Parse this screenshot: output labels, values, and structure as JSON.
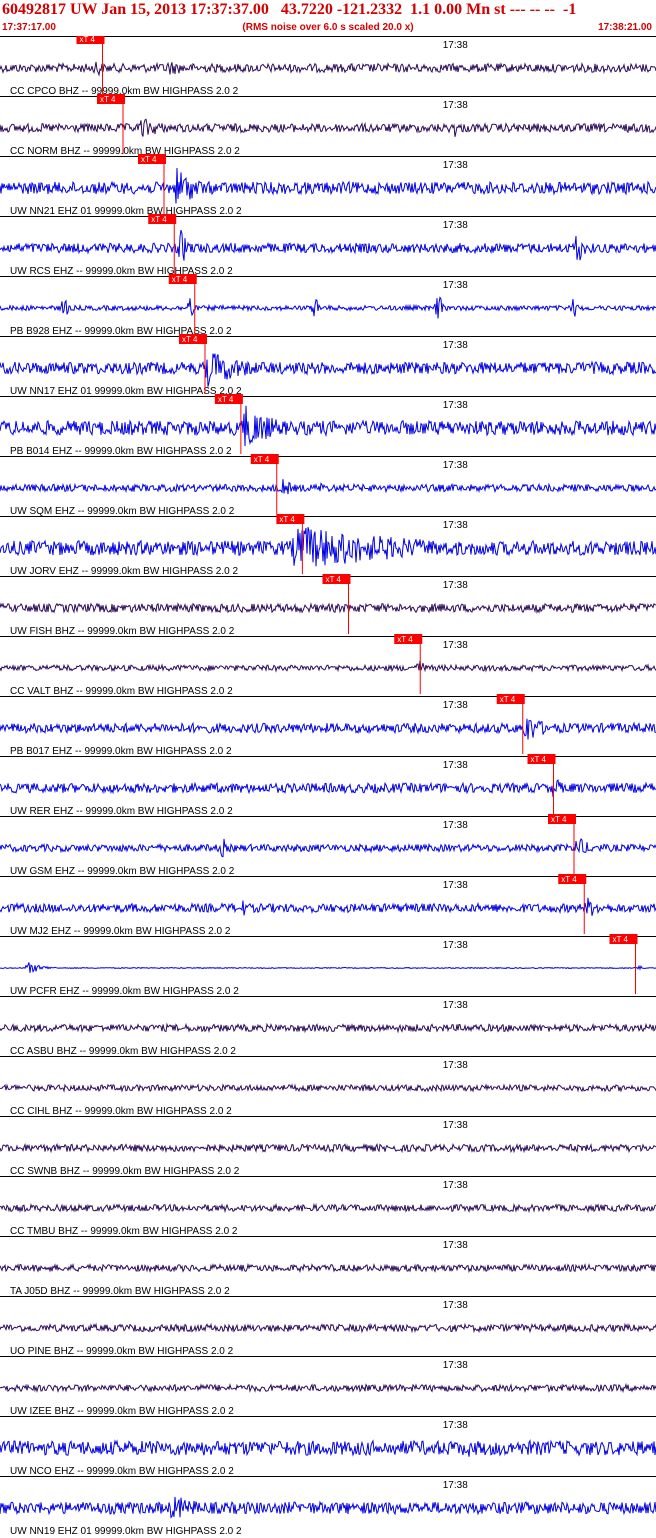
{
  "header": {
    "title": "60492817 UW Jan 15, 2013 17:37:37.00   43.7220 -121.2332  1.1 0.00 Mn st --- -- --  -1",
    "start_time": "17:37:17.00",
    "scale_note": "(RMS noise over 6.0 s scaled 20.0 x)",
    "end_time": "17:38:21.00"
  },
  "colors": {
    "blue_trace": "#0000e6",
    "dark_trace": "#2a0a5a",
    "pick": "#ff0000",
    "text": "#d40000",
    "label": "#000000"
  },
  "chart_data": {
    "type": "seismogram",
    "time_range": [
      "17:37:17.00",
      "17:38:21.00"
    ],
    "time_range_s": [
      0,
      64
    ],
    "minute_tick_label": "17:38",
    "minute_tick_s": 43,
    "pick_label": "xT 4",
    "traces": [
      {
        "label": "CC CPCO BHZ -- 99999.0km BW  HIGHPASS  2.0  2",
        "color": "dark",
        "pick_s": 10.0,
        "noise": 0.18,
        "bursts": [
          {
            "t": 9.2,
            "amp": 0.55,
            "dur": 1.0
          },
          {
            "t": 16.0,
            "amp": 0.35,
            "dur": 6.0
          }
        ]
      },
      {
        "label": "CC NORM BHZ -- 99999.0km BW  HIGHPASS  2.0  2",
        "color": "dark",
        "pick_s": 12.0,
        "noise": 0.18,
        "bursts": [
          {
            "t": 13.5,
            "amp": 0.45,
            "dur": 6.0
          },
          {
            "t": 44.0,
            "amp": 0.55,
            "dur": 0.6
          },
          {
            "t": 52.0,
            "amp": 0.2,
            "dur": 6.0
          }
        ]
      },
      {
        "label": "UW NN21 EHZ 01 99999.0km BW  HIGHPASS  2.0  2",
        "color": "blue",
        "pick_s": 16.0,
        "noise": 0.25,
        "bursts": [
          {
            "t": 17.0,
            "amp": 0.9,
            "dur": 5.0
          }
        ]
      },
      {
        "label": "UW RCS EHZ -- 99999.0km BW  HIGHPASS  2.0  2",
        "color": "blue",
        "pick_s": 17.0,
        "noise": 0.2,
        "bursts": [
          {
            "t": 17.3,
            "amp": 0.8,
            "dur": 2.0
          },
          {
            "t": 56.0,
            "amp": 0.8,
            "dur": 1.5
          }
        ]
      },
      {
        "label": "PB B928 EHZ -- 99999.0km BW  HIGHPASS  2.0  2",
        "color": "blue",
        "pick_s": 19.0,
        "noise": 0.1,
        "bursts": [
          {
            "t": 6.0,
            "amp": 0.6,
            "dur": 0.8
          },
          {
            "t": 18.3,
            "amp": 0.7,
            "dur": 0.8
          },
          {
            "t": 30.5,
            "amp": 0.6,
            "dur": 0.8
          },
          {
            "t": 42.5,
            "amp": 0.7,
            "dur": 0.8
          },
          {
            "t": 55.7,
            "amp": 0.5,
            "dur": 0.8
          }
        ]
      },
      {
        "label": "UW NN17 EHZ 01 99999.0km BW  HIGHPASS  2.0  2",
        "color": "blue",
        "pick_s": 20.0,
        "noise": 0.25,
        "bursts": [
          {
            "t": 20.0,
            "amp": 0.8,
            "dur": 9.0
          }
        ]
      },
      {
        "label": "PB B014 EHZ -- 99999.0km BW  HIGHPASS  2.0  2",
        "color": "blue",
        "pick_s": 23.5,
        "noise": 0.3,
        "bursts": [
          {
            "t": 23.5,
            "amp": 1.0,
            "dur": 7.0
          }
        ]
      },
      {
        "label": "UW SQM EHZ -- 99999.0km BW  HIGHPASS  2.0  2",
        "color": "blue",
        "pick_s": 27.0,
        "noise": 0.15,
        "bursts": [
          {
            "t": 27.5,
            "amp": 0.6,
            "dur": 1.0
          },
          {
            "t": 31.0,
            "amp": 0.3,
            "dur": 1.0
          }
        ]
      },
      {
        "label": "UW JORV EHZ -- 99999.0km BW  HIGHPASS  2.0  2",
        "color": "blue",
        "pick_s": 29.5,
        "noise": 0.3,
        "bursts": [
          {
            "t": 28.5,
            "amp": 1.0,
            "dur": 27.0
          }
        ]
      },
      {
        "label": "UW FISH BHZ -- 99999.0km BW  HIGHPASS  2.0  2",
        "color": "dark",
        "pick_s": 34.0,
        "noise": 0.18,
        "bursts": []
      },
      {
        "label": "CC VALT BHZ -- 99999.0km BW  HIGHPASS  2.0  2",
        "color": "dark",
        "pick_s": 41.0,
        "noise": 0.12,
        "bursts": [
          {
            "t": 40.5,
            "amp": 0.45,
            "dur": 1.5
          }
        ]
      },
      {
        "label": "PB B017 EHZ -- 99999.0km BW  HIGHPASS  2.0  2",
        "color": "blue",
        "pick_s": 51.0,
        "noise": 0.2,
        "bursts": [
          {
            "t": 51.0,
            "amp": 0.7,
            "dur": 4.0
          }
        ]
      },
      {
        "label": "UW RER EHZ -- 99999.0km BW  HIGHPASS  2.0  2",
        "color": "blue",
        "pick_s": 54.0,
        "noise": 0.2,
        "bursts": [
          {
            "t": 53.8,
            "amp": 0.6,
            "dur": 1.5
          }
        ]
      },
      {
        "label": "UW GSM EHZ -- 99999.0km BW  HIGHPASS  2.0  2",
        "color": "blue",
        "pick_s": 56.0,
        "noise": 0.15,
        "bursts": [
          {
            "t": 21.5,
            "amp": 0.5,
            "dur": 0.6
          },
          {
            "t": 56.0,
            "amp": 0.5,
            "dur": 3.0
          }
        ]
      },
      {
        "label": "UW MJ2 EHZ -- 99999.0km BW  HIGHPASS  2.0  2",
        "color": "blue",
        "pick_s": 57.0,
        "noise": 0.18,
        "bursts": [
          {
            "t": 23.5,
            "amp": 0.4,
            "dur": 0.6
          },
          {
            "t": 57.0,
            "amp": 0.45,
            "dur": 4.0
          }
        ]
      },
      {
        "label": "UW PCFR EHZ -- 99999.0km BW  HIGHPASS  2.0  2",
        "color": "blue",
        "pick_s": 62.0,
        "noise": 0.02,
        "bursts": [
          {
            "t": 2.5,
            "amp": 0.25,
            "dur": 3.0
          },
          {
            "t": 62.0,
            "amp": 0.2,
            "dur": 0.6
          }
        ]
      },
      {
        "label": "CC ASBU BHZ -- 99999.0km BW  HIGHPASS  2.0  2",
        "color": "dark",
        "pick_s": null,
        "noise": 0.15,
        "bursts": []
      },
      {
        "label": "CC CIHL BHZ -- 99999.0km BW  HIGHPASS  2.0  2",
        "color": "dark",
        "pick_s": null,
        "noise": 0.13,
        "bursts": []
      },
      {
        "label": "CC SWNB BHZ -- 99999.0km BW  HIGHPASS  2.0  2",
        "color": "dark",
        "pick_s": null,
        "noise": 0.15,
        "bursts": []
      },
      {
        "label": "CC TMBU BHZ -- 99999.0km BW  HIGHPASS  2.0  2",
        "color": "dark",
        "pick_s": null,
        "noise": 0.14,
        "bursts": []
      },
      {
        "label": "TA J05D BHZ -- 99999.0km BW  HIGHPASS  2.0  2",
        "color": "dark",
        "pick_s": null,
        "noise": 0.14,
        "bursts": []
      },
      {
        "label": "UO PINE BHZ -- 99999.0km BW  HIGHPASS  2.0  2",
        "color": "dark",
        "pick_s": null,
        "noise": 0.15,
        "bursts": []
      },
      {
        "label": "UW IZEE BHZ -- 99999.0km BW  HIGHPASS  2.0  2",
        "color": "dark",
        "pick_s": null,
        "noise": 0.14,
        "bursts": []
      },
      {
        "label": "UW NCO EHZ -- 99999.0km BW  HIGHPASS  2.0  2",
        "color": "blue",
        "pick_s": null,
        "noise": 0.3,
        "bursts": [
          {
            "t": 45.5,
            "amp": 0.4,
            "dur": 3.0
          }
        ]
      },
      {
        "label": "UW NN19 EHZ 01 99999.0km BW  HIGHPASS  2.0  2",
        "color": "blue",
        "pick_s": null,
        "noise": 0.25,
        "bursts": [
          {
            "t": 16.5,
            "amp": 0.55,
            "dur": 8.0
          }
        ]
      }
    ]
  }
}
